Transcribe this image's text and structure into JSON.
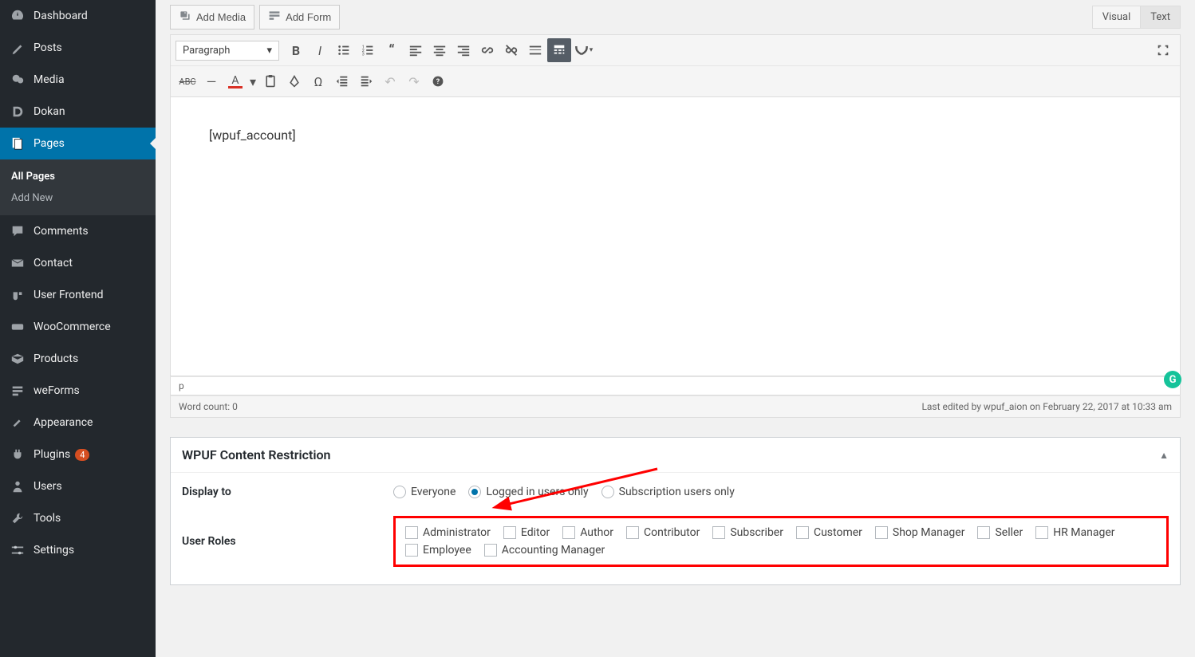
{
  "sidebar": {
    "items": [
      {
        "label": "Dashboard"
      },
      {
        "label": "Posts"
      },
      {
        "label": "Media"
      },
      {
        "label": "Dokan"
      },
      {
        "label": "Pages",
        "active": true,
        "sub": [
          {
            "label": "All Pages",
            "current": true
          },
          {
            "label": "Add New"
          }
        ]
      },
      {
        "label": "Comments"
      },
      {
        "label": "Contact"
      },
      {
        "label": "User Frontend"
      },
      {
        "label": "WooCommerce"
      },
      {
        "label": "Products"
      },
      {
        "label": "weForms"
      },
      {
        "label": "Appearance"
      },
      {
        "label": "Plugins",
        "badge": "4"
      },
      {
        "label": "Users"
      },
      {
        "label": "Tools"
      },
      {
        "label": "Settings"
      }
    ]
  },
  "buttons": {
    "add_media": "Add Media",
    "add_form": "Add Form"
  },
  "tabs": {
    "visual": "Visual",
    "text": "Text"
  },
  "format_selected": "Paragraph",
  "editor_content": "[wpuf_account]",
  "path_indicator": "p",
  "word_count": "Word count: 0",
  "last_edited": "Last edited by wpuf_aion on February 22, 2017 at 10:33 am",
  "restriction": {
    "title": "WPUF Content Restriction",
    "display_label": "Display to",
    "options": [
      "Everyone",
      "Logged in users only",
      "Subscription users only"
    ],
    "selected_index": 1,
    "roles_label": "User Roles",
    "roles": [
      "Administrator",
      "Editor",
      "Author",
      "Contributor",
      "Subscriber",
      "Customer",
      "Shop Manager",
      "Seller",
      "HR Manager",
      "Employee",
      "Accounting Manager"
    ]
  }
}
